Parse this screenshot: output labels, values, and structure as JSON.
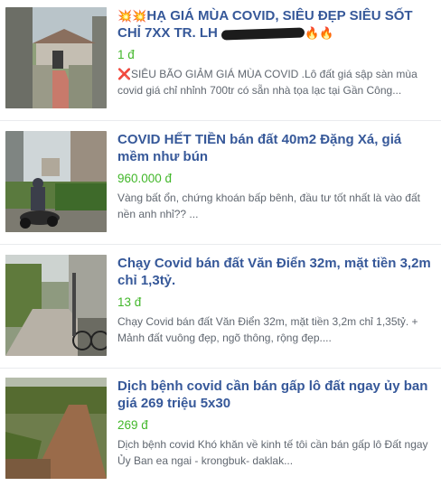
{
  "listings": [
    {
      "title_prefix_emoji": "💥💥",
      "title": "HẠ GIÁ MÙA COVID, SIÊU ĐẸP SIÊU SỐT CHỈ 7XX TR. LH",
      "title_suffix_emoji": "🔥🔥",
      "price": "1 đ",
      "desc_prefix_icon": "❌",
      "description": "SIÊU BÃO GIẢM GIÁ MÙA COVID .Lô đất giá sập sàn mùa covid giá chỉ nhỉnh 700tr có sẵn nhà tọa lạc tại Gần Công..."
    },
    {
      "title": "COVID HẾT TIỀN bán đất 40m2 Đặng Xá, giá mềm như bún",
      "price": "960.000 đ",
      "description": "Vàng bất ổn, chứng khoán bấp bênh, đầu tư tốt nhất là vào đất nền anh nhỉ?? ..."
    },
    {
      "title": "Chạy Covid bán đất Văn Điển 32m, mặt tiền 3,2m chỉ 1,3tỷ.",
      "price": "13 đ",
      "description": "Chạy Covid bán đất Văn Điển 32m, mặt tiền 3,2m chỉ 1,35tỷ. + Mảnh đất vuông đẹp, ngõ thông, rộng đẹp...."
    },
    {
      "title": "Dịch bệnh covid cần bán gấp lô đất ngay ủy ban giá 269 triệu 5x30",
      "price": "269 đ",
      "description": "Dịch bệnh covid Khó khăn về kinh tế tôi cần bán gấp lô Đất ngay Ủy Ban ea ngai - krongbuk- daklak..."
    }
  ],
  "colors": {
    "title": "#365899",
    "price": "#42b72a",
    "description": "#606770"
  }
}
